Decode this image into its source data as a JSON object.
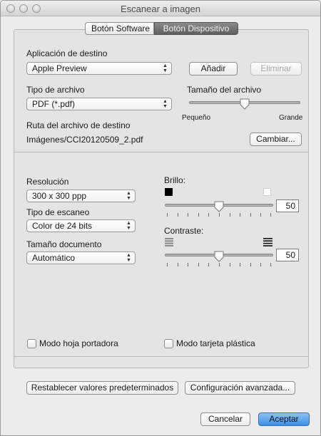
{
  "window": {
    "title": "Escanear a imagen"
  },
  "tabs": [
    {
      "label": "Botón Software",
      "selected": false
    },
    {
      "label": "Botón Dispositivo",
      "selected": true
    }
  ],
  "destination": {
    "app_label": "Aplicación de destino",
    "app_value": "Apple Preview",
    "add_button": "Añadir",
    "remove_button": "Eliminar",
    "file_type_label": "Tipo de archivo",
    "file_type_value": "PDF (*.pdf)",
    "file_size_label": "Tamaño del archivo",
    "file_size_min_label": "Pequeño",
    "file_size_max_label": "Grande",
    "file_size_level_percent": 50,
    "path_label": "Ruta del archivo de destino",
    "path_value": "Imágenes/CCI20120509_2.pdf",
    "change_button": "Cambiar..."
  },
  "scan": {
    "resolution_label": "Resolución",
    "resolution_value": "300 x 300 ppp",
    "scan_type_label": "Tipo de escaneo",
    "scan_type_value": "Color de 24 bits",
    "doc_size_label": "Tamaño documento",
    "doc_size_value": "Automático",
    "brightness_label": "Brillo:",
    "brightness_value": "50",
    "contrast_label": "Contraste:",
    "contrast_value": "50",
    "carrier_sheet_label": "Modo hoja portadora",
    "carrier_sheet_checked": false,
    "plastic_card_label": "Modo tarjeta plástica",
    "plastic_card_checked": false
  },
  "footer": {
    "restore_defaults_button": "Restablecer valores predeterminados",
    "advanced_settings_button": "Configuración avanzada...",
    "cancel_button": "Cancelar",
    "accept_button": "Aceptar"
  },
  "colors": {
    "primary_button": "#4a97e8",
    "selected_tab": "#6c6c6c"
  },
  "icons": {
    "brightness_low": "black-square-icon",
    "brightness_high": "white-square-icon",
    "contrast_low": "contrast-low-icon",
    "contrast_high": "contrast-high-icon"
  }
}
